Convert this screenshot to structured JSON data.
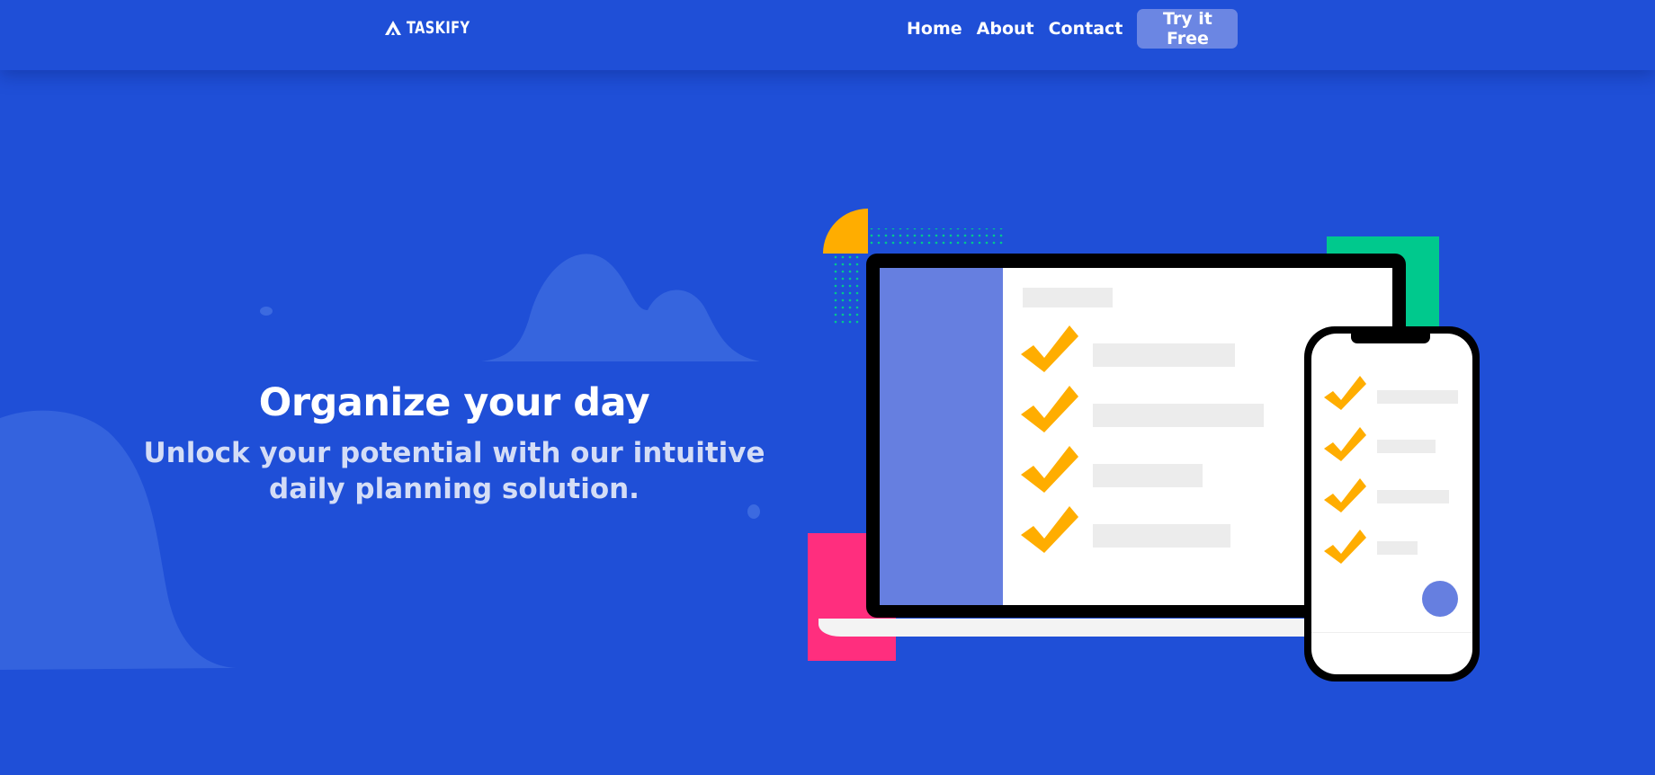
{
  "navbar": {
    "logo_text": "TASKIFY",
    "links": [
      "Home",
      "About",
      "Contact"
    ],
    "cta_label": "Try it Free"
  },
  "hero": {
    "title": "Organize your day",
    "subtitle": "Unlock your potential with our intuitive daily planning solution."
  },
  "colors": {
    "background": "#1f4fd7",
    "button": "#6b86e3",
    "checkmark": "#ffad00",
    "accent_pink": "#ff2e7e",
    "accent_green": "#00c98d",
    "sidebar": "#667fe0"
  }
}
